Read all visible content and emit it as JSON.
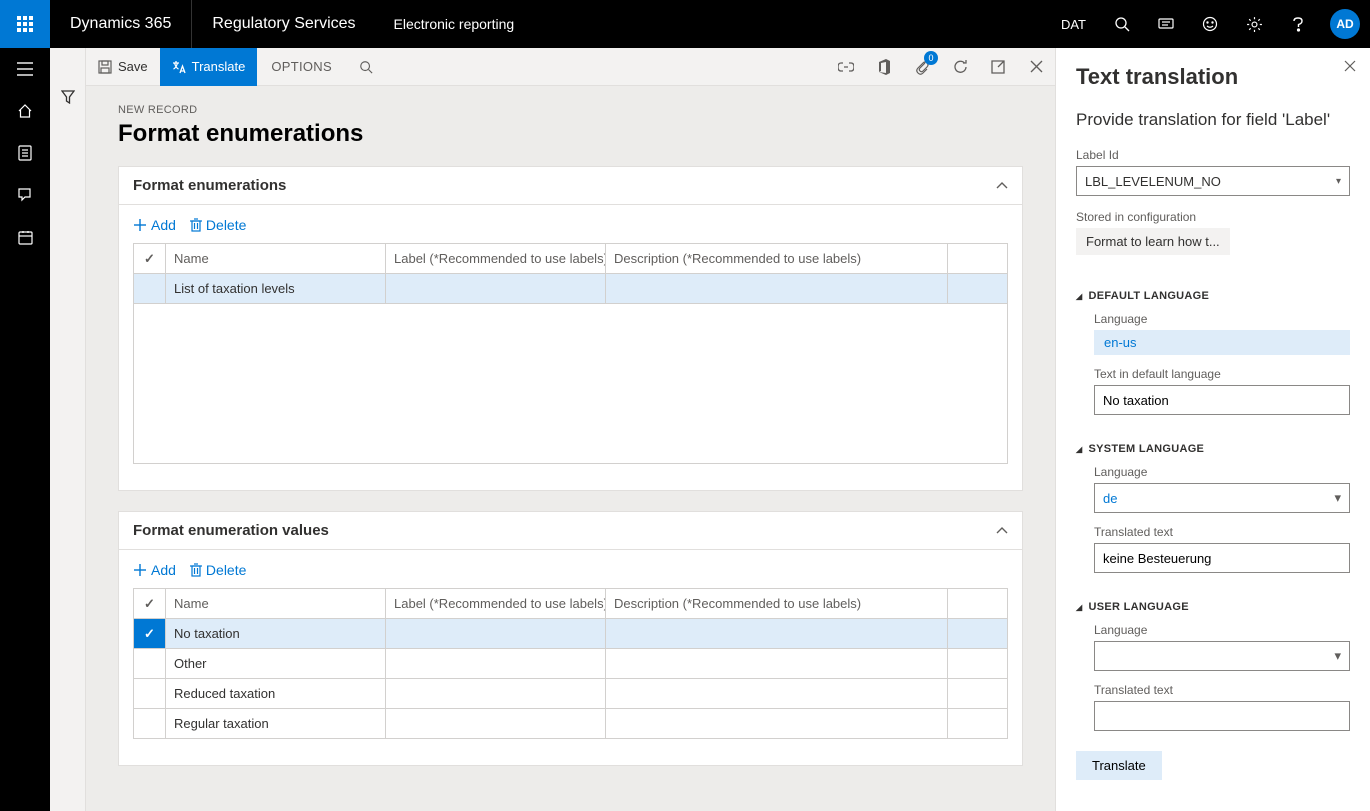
{
  "topbar": {
    "product": "Dynamics 365",
    "module": "Regulatory Services",
    "area": "Electronic reporting",
    "company": "DAT",
    "avatar": "AD"
  },
  "actionbar": {
    "save": "Save",
    "translate": "Translate",
    "options": "OPTIONS",
    "attachments_count": "0"
  },
  "page": {
    "breadcrumb": "NEW RECORD",
    "title": "Format enumerations"
  },
  "section_enum": {
    "title": "Format enumerations",
    "add": "Add",
    "delete": "Delete",
    "headers": {
      "name": "Name",
      "label": "Label (*Recommended to use labels)",
      "description": "Description (*Recommended to use labels)"
    },
    "rows": [
      {
        "name": "List of taxation levels",
        "label": "",
        "description": "",
        "selected": true
      }
    ]
  },
  "section_values": {
    "title": "Format enumeration values",
    "add": "Add",
    "delete": "Delete",
    "headers": {
      "name": "Name",
      "label": "Label (*Recommended to use labels)",
      "description": "Description (*Recommended to use labels)"
    },
    "rows": [
      {
        "name": "No taxation",
        "label": "",
        "description": "",
        "selected": true
      },
      {
        "name": "Other",
        "label": "",
        "description": "",
        "selected": false
      },
      {
        "name": "Reduced taxation",
        "label": "",
        "description": "",
        "selected": false
      },
      {
        "name": "Regular taxation",
        "label": "",
        "description": "",
        "selected": false
      }
    ]
  },
  "side": {
    "title": "Text translation",
    "subtitle": "Provide translation for field 'Label'",
    "label_id_label": "Label Id",
    "label_id_value": "LBL_LEVELENUM_NO",
    "stored_label": "Stored in configuration",
    "stored_value": "Format to learn how t...",
    "default_section": "DEFAULT LANGUAGE",
    "language_label": "Language",
    "default_lang": "en-us",
    "default_text_label": "Text in default language",
    "default_text_value": "No taxation",
    "system_section": "SYSTEM LANGUAGE",
    "system_lang": "de",
    "translated_label": "Translated text",
    "system_text_value": "keine Besteuerung",
    "user_section": "USER LANGUAGE",
    "user_lang": "",
    "user_text_value": "",
    "translate_btn": "Translate"
  }
}
